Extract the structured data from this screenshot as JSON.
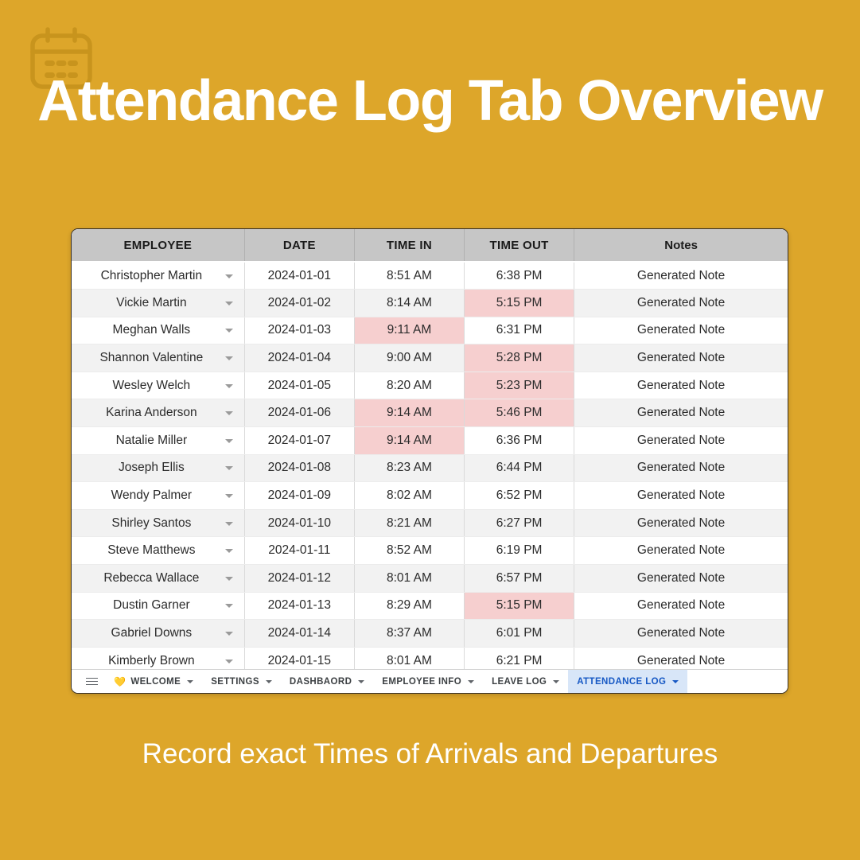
{
  "theme": {
    "background": "#dda62a",
    "icon_color": "#c8941d",
    "title_color": "#ffffff",
    "highlight_color": "#f6cfcf",
    "active_tab_bg": "#d8e6f8",
    "active_tab_text": "#1658c4"
  },
  "header_icon": "calendar-icon",
  "title": "Attendance Log Tab Overview",
  "caption": "Record exact Times of Arrivals and Departures",
  "table": {
    "columns": [
      "EMPLOYEE",
      "DATE",
      "TIME IN",
      "TIME OUT",
      "Notes"
    ],
    "rows": [
      {
        "employee": "Christopher Martin",
        "date": "2024-01-01",
        "time_in": "8:51 AM",
        "time_out": "6:38 PM",
        "notes": "Generated Note",
        "in_flag": false,
        "out_flag": false
      },
      {
        "employee": "Vickie Martin",
        "date": "2024-01-02",
        "time_in": "8:14 AM",
        "time_out": "5:15 PM",
        "notes": "Generated Note",
        "in_flag": false,
        "out_flag": true
      },
      {
        "employee": "Meghan Walls",
        "date": "2024-01-03",
        "time_in": "9:11 AM",
        "time_out": "6:31 PM",
        "notes": "Generated Note",
        "in_flag": true,
        "out_flag": false
      },
      {
        "employee": "Shannon Valentine",
        "date": "2024-01-04",
        "time_in": "9:00 AM",
        "time_out": "5:28 PM",
        "notes": "Generated Note",
        "in_flag": false,
        "out_flag": true
      },
      {
        "employee": "Wesley Welch",
        "date": "2024-01-05",
        "time_in": "8:20 AM",
        "time_out": "5:23 PM",
        "notes": "Generated Note",
        "in_flag": false,
        "out_flag": true
      },
      {
        "employee": "Karina Anderson",
        "date": "2024-01-06",
        "time_in": "9:14 AM",
        "time_out": "5:46 PM",
        "notes": "Generated Note",
        "in_flag": true,
        "out_flag": true
      },
      {
        "employee": "Natalie Miller",
        "date": "2024-01-07",
        "time_in": "9:14 AM",
        "time_out": "6:36 PM",
        "notes": "Generated Note",
        "in_flag": true,
        "out_flag": false
      },
      {
        "employee": "Joseph Ellis",
        "date": "2024-01-08",
        "time_in": "8:23 AM",
        "time_out": "6:44 PM",
        "notes": "Generated Note",
        "in_flag": false,
        "out_flag": false
      },
      {
        "employee": "Wendy Palmer",
        "date": "2024-01-09",
        "time_in": "8:02 AM",
        "time_out": "6:52 PM",
        "notes": "Generated Note",
        "in_flag": false,
        "out_flag": false
      },
      {
        "employee": "Shirley Santos",
        "date": "2024-01-10",
        "time_in": "8:21 AM",
        "time_out": "6:27 PM",
        "notes": "Generated Note",
        "in_flag": false,
        "out_flag": false
      },
      {
        "employee": "Steve Matthews",
        "date": "2024-01-11",
        "time_in": "8:52 AM",
        "time_out": "6:19 PM",
        "notes": "Generated Note",
        "in_flag": false,
        "out_flag": false
      },
      {
        "employee": "Rebecca Wallace",
        "date": "2024-01-12",
        "time_in": "8:01 AM",
        "time_out": "6:57 PM",
        "notes": "Generated Note",
        "in_flag": false,
        "out_flag": false
      },
      {
        "employee": "Dustin Garner",
        "date": "2024-01-13",
        "time_in": "8:29 AM",
        "time_out": "5:15 PM",
        "notes": "Generated Note",
        "in_flag": false,
        "out_flag": true
      },
      {
        "employee": "Gabriel Downs",
        "date": "2024-01-14",
        "time_in": "8:37 AM",
        "time_out": "6:01 PM",
        "notes": "Generated Note",
        "in_flag": false,
        "out_flag": false
      },
      {
        "employee": "Kimberly Brown",
        "date": "2024-01-15",
        "time_in": "8:01 AM",
        "time_out": "6:21 PM",
        "notes": "Generated Note",
        "in_flag": false,
        "out_flag": false
      }
    ]
  },
  "tabbar": {
    "menu_icon": "hamburger-icon",
    "tabs": [
      {
        "label": "WELCOME",
        "emoji": "💛",
        "active": false
      },
      {
        "label": "SETTINGS",
        "emoji": "",
        "active": false
      },
      {
        "label": "DASHBAORD",
        "emoji": "",
        "active": false
      },
      {
        "label": "EMPLOYEE INFO",
        "emoji": "",
        "active": false
      },
      {
        "label": "LEAVE LOG",
        "emoji": "",
        "active": false
      },
      {
        "label": "ATTENDANCE LOG",
        "emoji": "",
        "active": true
      }
    ]
  }
}
